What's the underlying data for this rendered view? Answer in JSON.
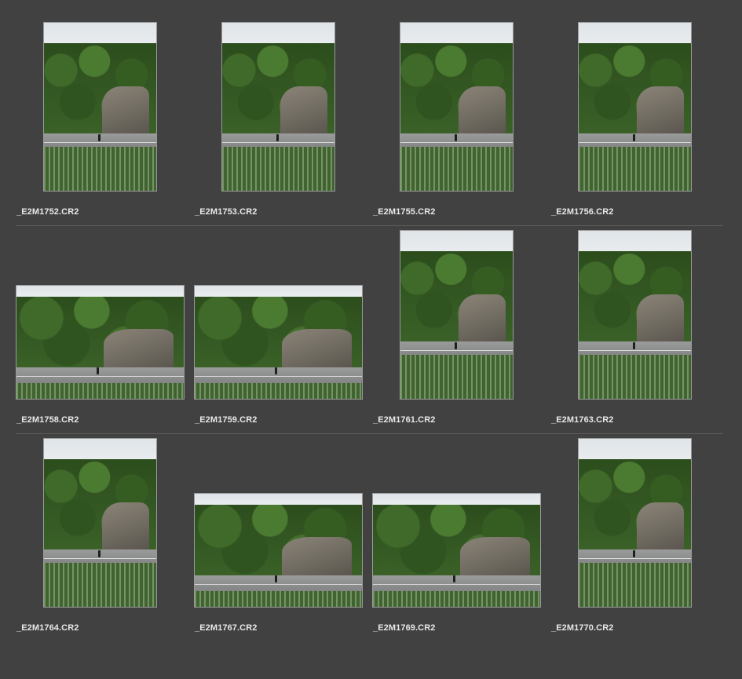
{
  "thumbnails": [
    {
      "filename": "_E2M1752.CR2",
      "orientation": "portrait"
    },
    {
      "filename": "_E2M1753.CR2",
      "orientation": "portrait"
    },
    {
      "filename": "_E2M1755.CR2",
      "orientation": "portrait"
    },
    {
      "filename": "_E2M1756.CR2",
      "orientation": "portrait"
    },
    {
      "filename": "_E2M1758.CR2",
      "orientation": "landscape"
    },
    {
      "filename": "_E2M1759.CR2",
      "orientation": "landscape"
    },
    {
      "filename": "_E2M1761.CR2",
      "orientation": "portrait"
    },
    {
      "filename": "_E2M1763.CR2",
      "orientation": "portrait"
    },
    {
      "filename": "_E2M1764.CR2",
      "orientation": "portrait"
    },
    {
      "filename": "_E2M1767.CR2",
      "orientation": "landscape"
    },
    {
      "filename": "_E2M1769.CR2",
      "orientation": "landscape"
    },
    {
      "filename": "_E2M1770.CR2",
      "orientation": "portrait"
    }
  ],
  "colors": {
    "background": "#414141",
    "caption": "#e8e8e8",
    "divider": "#5c5c5c",
    "thumb_border": "#9a9a9a"
  }
}
